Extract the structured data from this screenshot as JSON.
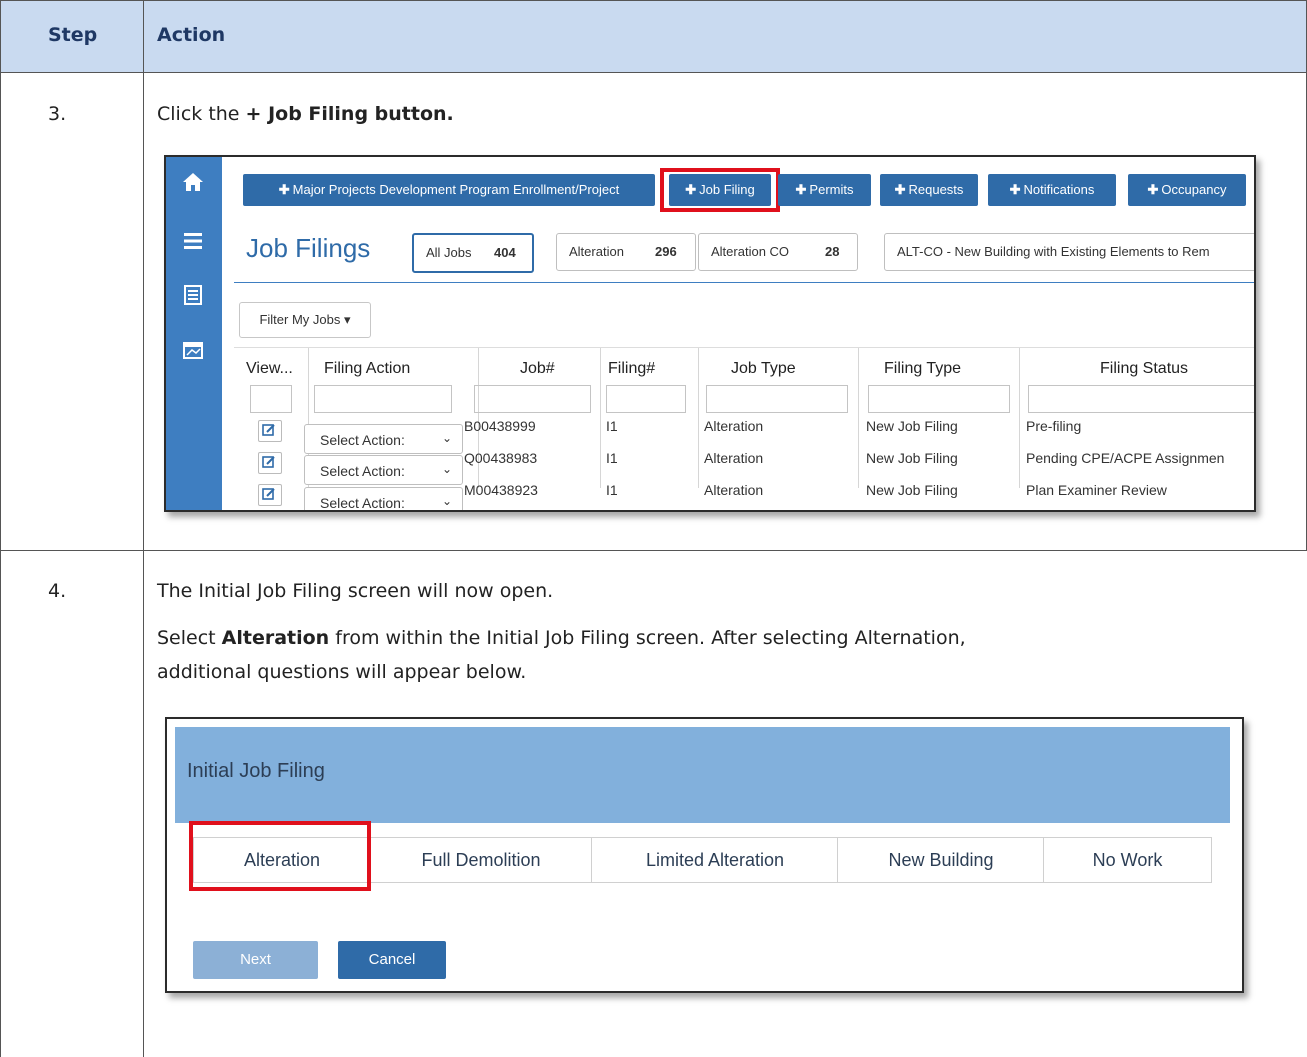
{
  "table": {
    "headers": {
      "step": "Step",
      "action": "Action"
    },
    "rows": [
      {
        "step": "3.",
        "instruction_prefix": "Click the ",
        "instruction_bold": "+ Job Filing button."
      },
      {
        "step": "4.",
        "line1": "The Initial Job Filing screen will now open.",
        "line2_prefix": "Select ",
        "line2_bold": "Alteration",
        "line2_suffix": " from within the Initial Job Filing screen.  After selecting Alternation,",
        "line3": "additional questions will appear below."
      }
    ]
  },
  "job_filings_screen": {
    "top_buttons": [
      {
        "label": "Major Projects Development Program Enrollment/Project",
        "icon": "plus-icon"
      },
      {
        "label": "Job Filing",
        "icon": "plus-icon",
        "highlighted": true
      },
      {
        "label": "Permits",
        "icon": "plus-icon"
      },
      {
        "label": "Requests",
        "icon": "plus-icon"
      },
      {
        "label": "Notifications",
        "icon": "plus-icon"
      },
      {
        "label": "Occupancy",
        "icon": "plus-icon"
      }
    ],
    "rail_icons": [
      "home-icon",
      "menu-icon",
      "list-icon",
      "screen-icon"
    ],
    "title": "Job Filings",
    "chips": [
      {
        "label": "All Jobs",
        "count": "404",
        "active": true
      },
      {
        "label": "Alteration",
        "count": "296"
      },
      {
        "label": "Alteration CO",
        "count": "28"
      },
      {
        "label": "ALT-CO - New Building with Existing Elements to Rem"
      }
    ],
    "filter_button": "Filter My Jobs",
    "columns": [
      "View...",
      "Filing Action",
      "Job#",
      "Filing#",
      "Job Type",
      "Filing Type",
      "Filing Status"
    ],
    "select_placeholder": "Select Action:",
    "rows": [
      {
        "job": "B00438999",
        "filing": "I1",
        "job_type": "Alteration",
        "filing_type": "New Job Filing",
        "status": "Pre-filing"
      },
      {
        "job": "Q00438983",
        "filing": "I1",
        "job_type": "Alteration",
        "filing_type": "New Job Filing",
        "status": "Pending CPE/ACPE Assignmen"
      },
      {
        "job": "M00438923",
        "filing": "I1",
        "job_type": "Alteration",
        "filing_type": "New Job Filing",
        "status": "Plan Examiner Review"
      }
    ],
    "accent_color": "#2f6ba8",
    "highlight_color": "#e0101c"
  },
  "initial_job_filing_screen": {
    "title": "Initial Job Filing",
    "options": [
      "Alteration",
      "Full Demolition",
      "Limited Alteration",
      "New Building",
      "No Work"
    ],
    "selected_option": "Alteration",
    "next_button": "Next",
    "cancel_button": "Cancel",
    "header_color": "#82b0dc"
  }
}
